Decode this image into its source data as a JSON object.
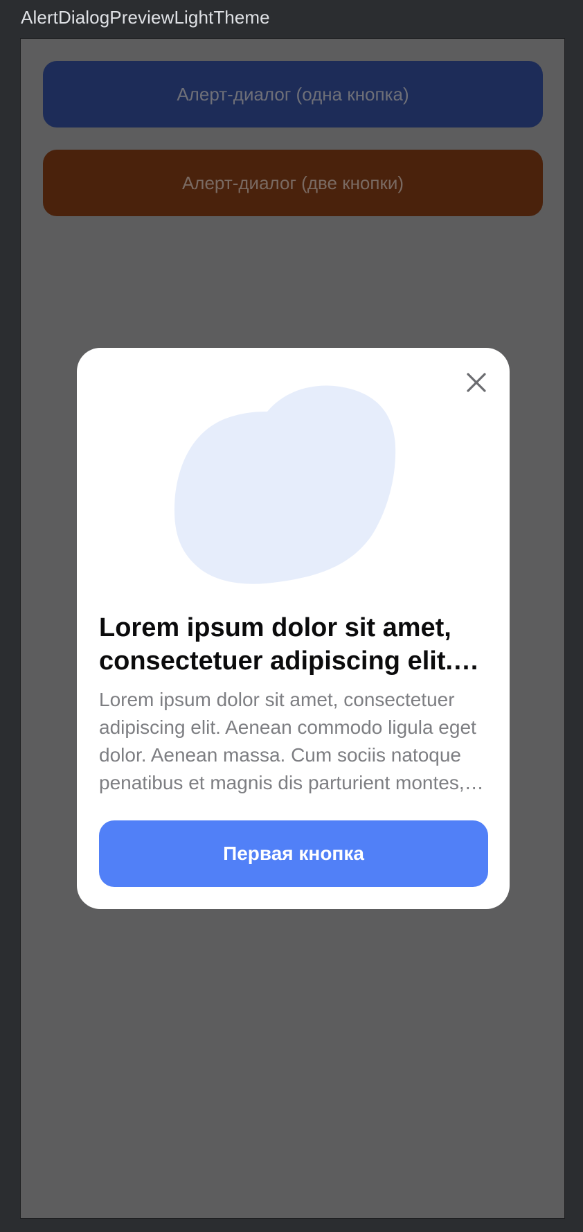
{
  "window": {
    "title": "AlertDialogPreviewLightTheme"
  },
  "background_buttons": [
    {
      "label": "Алерт-диалог (одна кнопка)"
    },
    {
      "label": "Алерт-диалог (две кнопки)"
    }
  ],
  "dialog": {
    "close_icon": "close-icon",
    "illustration": "blob-illustration",
    "title": "Lorem ipsum dolor sit amet, consectetuer adipiscing elit. Aenean commodo ligula eget dolor",
    "body": "Lorem ipsum dolor sit amet, consectetuer adipiscing elit. Aenean commodo ligula eget dolor. Aenean massa. Cum sociis natoque penatibus et magnis dis parturient montes, nascetur ridiculus mus.",
    "primary_button_label": "Первая кнопка"
  },
  "colors": {
    "app_background": "#2b2d30",
    "scrim": "#5d5d5e",
    "dialog_background": "#ffffff",
    "accent": "#5180f7",
    "blob": "#e6edfb",
    "button_one_dimmed": "#1d2c58",
    "button_two_dimmed": "#4a220c"
  }
}
